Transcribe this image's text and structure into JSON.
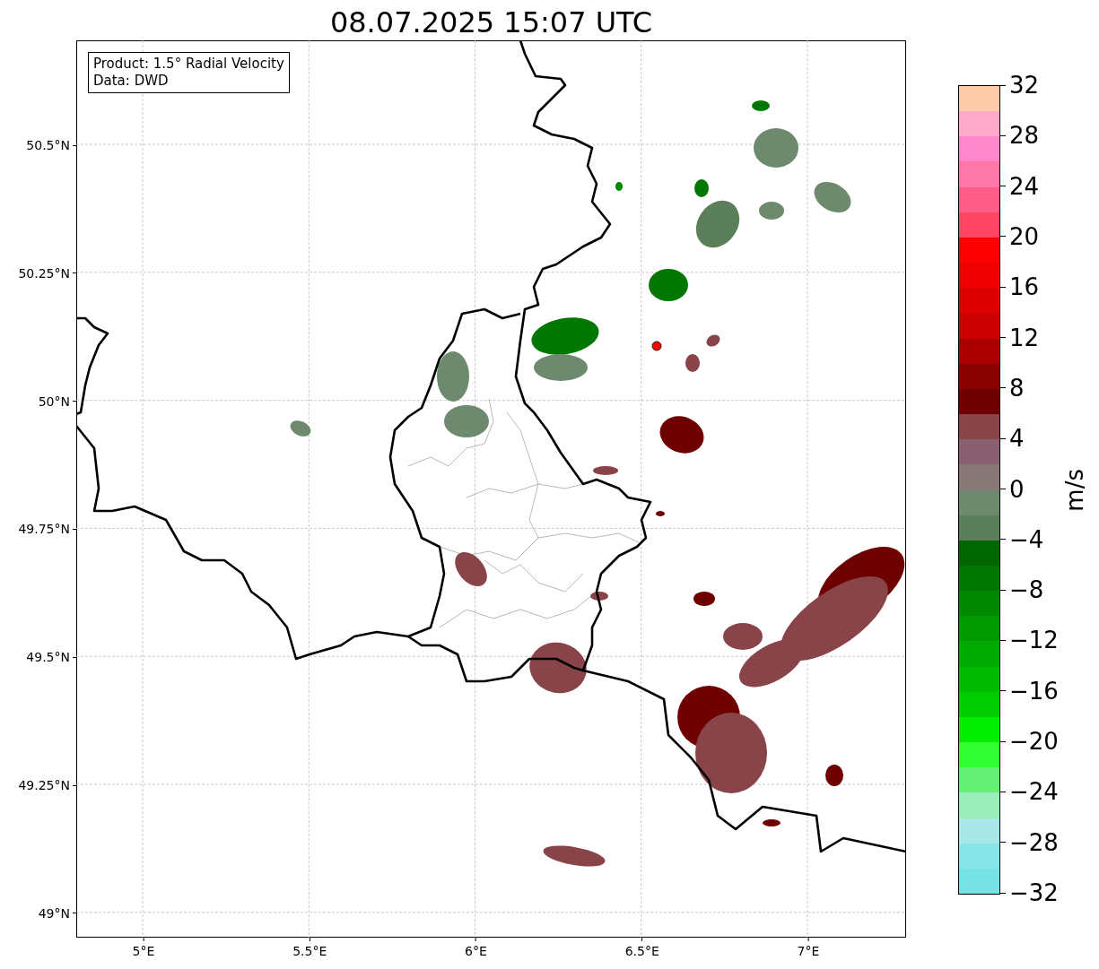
{
  "title": "08.07.2025 15:07 UTC",
  "legend": {
    "lines": [
      "Product: 1.5° Radial Velocity",
      "Data: DWD"
    ]
  },
  "x_axis": {
    "ticks": [
      "5°E",
      "5.5°E",
      "6°E",
      "6.5°E",
      "7°E"
    ]
  },
  "y_axis": {
    "ticks": [
      "50.5°N",
      "50.25°N",
      "50°N",
      "49.75°N",
      "49.5°N",
      "49.25°N",
      "49°N"
    ]
  },
  "colorbar": {
    "label": "m/s",
    "ticks": [
      "32",
      "28",
      "24",
      "20",
      "16",
      "12",
      "8",
      "4",
      "0",
      "−4",
      "−8",
      "−12",
      "−16",
      "−20",
      "−24",
      "−28",
      "−32"
    ],
    "bands": [
      {
        "color": "#ffccaa"
      },
      {
        "color": "#ffaac8"
      },
      {
        "color": "#ff88cc"
      },
      {
        "color": "#ff77a8"
      },
      {
        "color": "#ff5c88"
      },
      {
        "color": "#ff4466"
      },
      {
        "color": "#ff0000"
      },
      {
        "color": "#ee0000"
      },
      {
        "color": "#dd0000"
      },
      {
        "color": "#cc0000"
      },
      {
        "color": "#aa0000"
      },
      {
        "color": "#880000"
      },
      {
        "color": "#6f0000"
      },
      {
        "color": "#884448"
      },
      {
        "color": "#886070"
      },
      {
        "color": "#887878"
      },
      {
        "color": "#6e8a6e"
      },
      {
        "color": "#5a7f5a"
      },
      {
        "color": "#006600"
      },
      {
        "color": "#007700"
      },
      {
        "color": "#008800"
      },
      {
        "color": "#009900"
      },
      {
        "color": "#00aa00"
      },
      {
        "color": "#00bb00"
      },
      {
        "color": "#00cc00"
      },
      {
        "color": "#00ee00"
      },
      {
        "color": "#33ff33"
      },
      {
        "color": "#66f077"
      },
      {
        "color": "#99eebb"
      },
      {
        "color": "#aae8e8"
      },
      {
        "color": "#88e6e8"
      },
      {
        "color": "#77e2e6"
      }
    ]
  }
}
